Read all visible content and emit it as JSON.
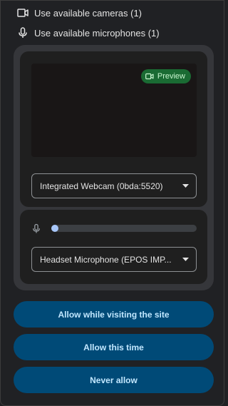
{
  "permissions": {
    "camera_label": "Use available cameras (1)",
    "microphone_label": "Use available microphones (1)"
  },
  "video": {
    "preview_badge": "Preview",
    "camera_select_value": "Integrated Webcam (0bda:5520)"
  },
  "audio": {
    "mic_level": 0,
    "mic_select_value": "Headset Microphone (EPOS IMP..."
  },
  "actions": {
    "allow_visiting": "Allow while visiting the site",
    "allow_once": "Allow this time",
    "never_allow": "Never allow"
  },
  "icons": {
    "camera": "camera-icon",
    "microphone": "microphone-icon",
    "caret": "caret-down-icon"
  },
  "colors": {
    "background": "#202124",
    "panel": "#35363a",
    "card": "#1f1f1f",
    "button_bg": "#004a77",
    "button_text": "#c2e7ff",
    "preview_badge_bg": "#1a6b33",
    "level_thumb": "#a8c7fa"
  }
}
